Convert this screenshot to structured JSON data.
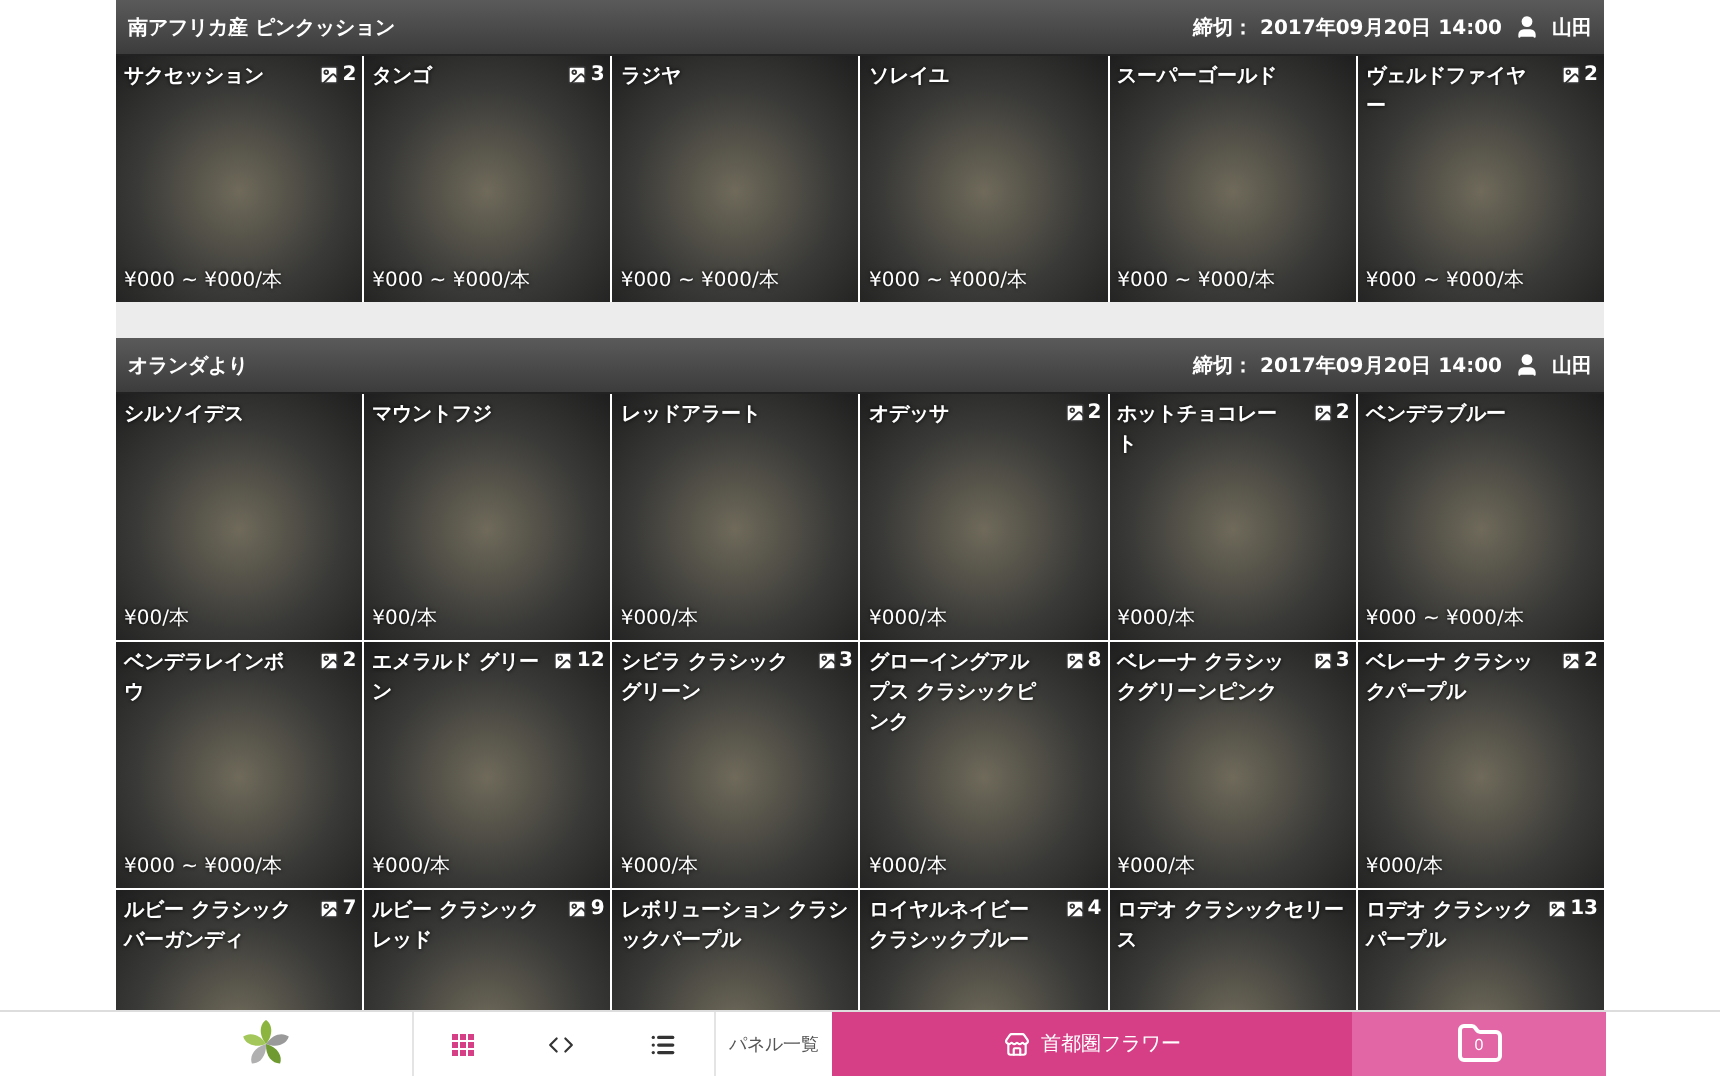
{
  "sections": [
    {
      "title": "南アフリカ産 ピンクッション",
      "deadline_label": "締切：",
      "deadline": "2017年09月20日 14:00",
      "user": "山田",
      "items": [
        {
          "name": "サクセッション",
          "photos": "2",
          "price": "¥000 ~ ¥000/本"
        },
        {
          "name": "タンゴ",
          "photos": "3",
          "price": "¥000 ~ ¥000/本"
        },
        {
          "name": "ラジヤ",
          "price": "¥000 ~ ¥000/本"
        },
        {
          "name": "ソレイユ",
          "price": "¥000 ~ ¥000/本"
        },
        {
          "name": "スーパーゴールド",
          "price": "¥000 ~ ¥000/本"
        },
        {
          "name": "ヴェルドファイヤー",
          "photos": "2",
          "price": "¥000 ~ ¥000/本"
        }
      ]
    },
    {
      "title": "オランダより",
      "deadline_label": "締切：",
      "deadline": "2017年09月20日 14:00",
      "user": "山田",
      "items": [
        {
          "name": "シルソイデス",
          "price": "¥00/本"
        },
        {
          "name": "マウントフジ",
          "price": "¥00/本"
        },
        {
          "name": "レッドアラート",
          "price": "¥000/本"
        },
        {
          "name": "オデッサ",
          "photos": "2",
          "price": "¥000/本"
        },
        {
          "name": "ホットチョコレート",
          "photos": "2",
          "price": "¥000/本"
        },
        {
          "name": "ベンデラブルー",
          "price": "¥000 ~ ¥000/本"
        },
        {
          "name": "ベンデラレインボウ",
          "photos": "2",
          "price": "¥000 ~ ¥000/本"
        },
        {
          "name": "エメラルド グリーン",
          "photos": "12",
          "price": "¥000/本"
        },
        {
          "name": "シビラ クラシックグリーン",
          "photos": "3",
          "price": "¥000/本"
        },
        {
          "name": "グローイングアルプス クラシックピンク",
          "photos": "8",
          "price": "¥000/本"
        },
        {
          "name": "ベレーナ クラシックグリーンピンク",
          "photos": "3",
          "price": "¥000/本"
        },
        {
          "name": "ベレーナ クラシックパープル",
          "photos": "2",
          "price": "¥000/本"
        },
        {
          "name": "ルビー クラシックバーガンディ",
          "photos": "7"
        },
        {
          "name": "ルビー クラシックレッド",
          "photos": "9"
        },
        {
          "name": "レボリューション クラシックパープル"
        },
        {
          "name": "ロイヤルネイビークラシックブルー",
          "photos": "4"
        },
        {
          "name": "ロデオ クラシックセリース"
        },
        {
          "name": "ロデオ クラシックパープル",
          "photos": "13"
        }
      ]
    }
  ],
  "bottom_bar": {
    "views": [
      {
        "kind": "grid",
        "selected": true
      },
      {
        "kind": "code",
        "selected": false
      },
      {
        "kind": "list",
        "selected": false
      }
    ],
    "view_label": "パネル一覧",
    "shop": "首都圏フラワー",
    "folder_count": "0"
  }
}
